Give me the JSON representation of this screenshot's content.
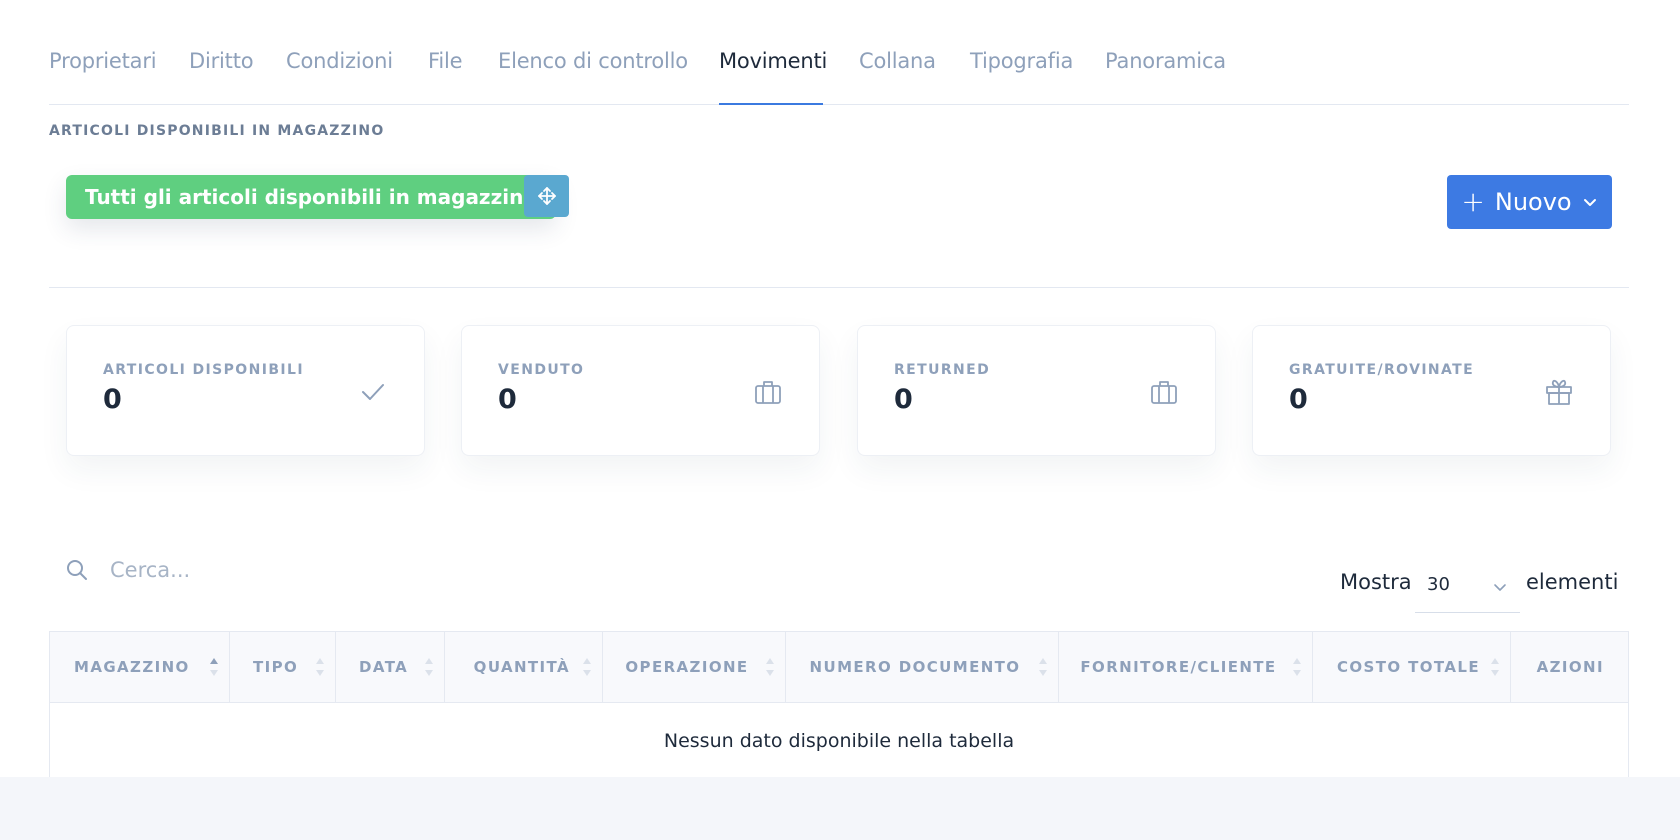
{
  "tabs": [
    {
      "label": "Proprietari",
      "active": false
    },
    {
      "label": "Diritto",
      "active": false
    },
    {
      "label": "Condizioni",
      "active": false
    },
    {
      "label": "File",
      "active": false
    },
    {
      "label": "Elenco di controllo",
      "active": false
    },
    {
      "label": "Movimenti",
      "active": true
    },
    {
      "label": "Collana",
      "active": false
    },
    {
      "label": "Tipografia",
      "active": false
    },
    {
      "label": "Panoramica",
      "active": false
    }
  ],
  "section_label": "ARTICOLI DISPONIBILI IN MAGAZZINO",
  "filter_pill": "Tutti gli articoli disponibili in magazzino",
  "move_button_icon": "move-arrows-icon",
  "new_button": {
    "plus": "+",
    "label": "Nuovo",
    "icon": "chevron-down-icon"
  },
  "cards": [
    {
      "label": "ARTICOLI DISPONIBILI",
      "value": "0",
      "icon": "check-icon"
    },
    {
      "label": "VENDUTO",
      "value": "0",
      "icon": "briefcase-icon"
    },
    {
      "label": "RETURNED",
      "value": "0",
      "icon": "briefcase-icon"
    },
    {
      "label": "GRATUITE/ROVINATE",
      "value": "0",
      "icon": "gift-icon"
    }
  ],
  "search": {
    "placeholder": "Cerca..."
  },
  "page_size": {
    "prefix": "Mostra",
    "value": "30",
    "suffix": "elementi"
  },
  "table": {
    "columns": [
      "MAGAZZINO",
      "TIPO",
      "DATA",
      "QUANTITÀ",
      "OPERAZIONE",
      "NUMERO DOCUMENTO",
      "FORNITORE/CLIENTE",
      "COSTO TOTALE",
      "AZIONI"
    ],
    "empty_message": "Nessun dato disponibile nella tabella"
  },
  "colors": {
    "accent": "#3d7ae3",
    "pill_green": "#5fcf80",
    "move_blue": "#5aa8d0",
    "muted_text": "#8ea0ba",
    "dark_text": "#1e2a3b"
  }
}
